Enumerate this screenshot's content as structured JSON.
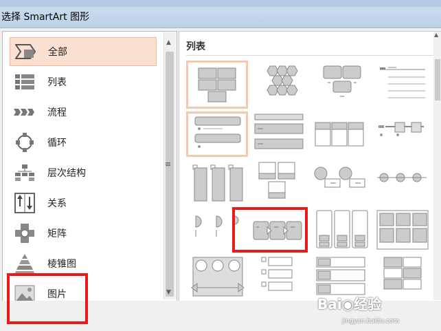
{
  "window": {
    "title": "选择 SmartArt 图形"
  },
  "categories": [
    {
      "label": "全部",
      "icon": "all-icon",
      "selected": true
    },
    {
      "label": "列表",
      "icon": "list-icon"
    },
    {
      "label": "流程",
      "icon": "process-icon"
    },
    {
      "label": "循环",
      "icon": "cycle-icon"
    },
    {
      "label": "层次结构",
      "icon": "hierarchy-icon"
    },
    {
      "label": "关系",
      "icon": "relationship-icon"
    },
    {
      "label": "矩阵",
      "icon": "matrix-icon"
    },
    {
      "label": "棱锥图",
      "icon": "pyramid-icon"
    },
    {
      "label": "图片",
      "icon": "picture-icon"
    }
  ],
  "gallery": {
    "section_title": "列表",
    "selected_tile": "process-arrows-tile"
  },
  "watermark": {
    "brand": "Bai",
    "brand2": "经验",
    "url": "jingyan.baidu.com"
  },
  "colors": {
    "selection_fill": "#fbdfd0",
    "selection_border": "#f3b89c",
    "highlight_red": "#e81a1a"
  }
}
